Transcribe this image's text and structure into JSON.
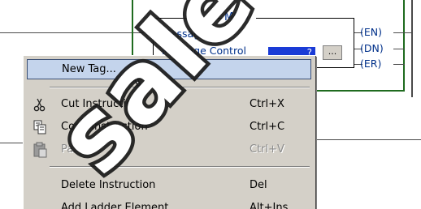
{
  "ladder": {
    "block_title": "MSG",
    "message_label": "Message",
    "message_control_label": "Message Control",
    "message_control_value": "?",
    "browse_button_label": "...",
    "coils": [
      "(EN)",
      "(DN)",
      "(ER)"
    ]
  },
  "context_menu": {
    "items": [
      {
        "label": "New Tag...",
        "shortcut": "",
        "enabled": true,
        "highlighted": true,
        "icon": ""
      },
      {
        "label": "Cut Instruction",
        "shortcut": "Ctrl+X",
        "enabled": true,
        "highlighted": false,
        "icon": "scissors-icon"
      },
      {
        "label": "Copy Instruction",
        "shortcut": "Ctrl+C",
        "enabled": true,
        "highlighted": false,
        "icon": "copy-icon"
      },
      {
        "label": "Paste",
        "shortcut": "Ctrl+V",
        "enabled": false,
        "highlighted": false,
        "icon": "paste-icon"
      },
      {
        "label": "Delete Instruction",
        "shortcut": "Del",
        "enabled": true,
        "highlighted": false,
        "icon": ""
      },
      {
        "label": "Add Ladder Element...",
        "shortcut": "Alt+Ins",
        "enabled": true,
        "highlighted": false,
        "icon": ""
      }
    ]
  },
  "watermark": {
    "text": "sale"
  },
  "colors": {
    "block_border": "#1f6b1f",
    "block_text": "#00308a",
    "tag_field_bg": "#1a3bd6",
    "menu_bg": "#d4d0c8",
    "highlight_bg": "#c4d4ec",
    "watermark": "#1a1a1a"
  }
}
